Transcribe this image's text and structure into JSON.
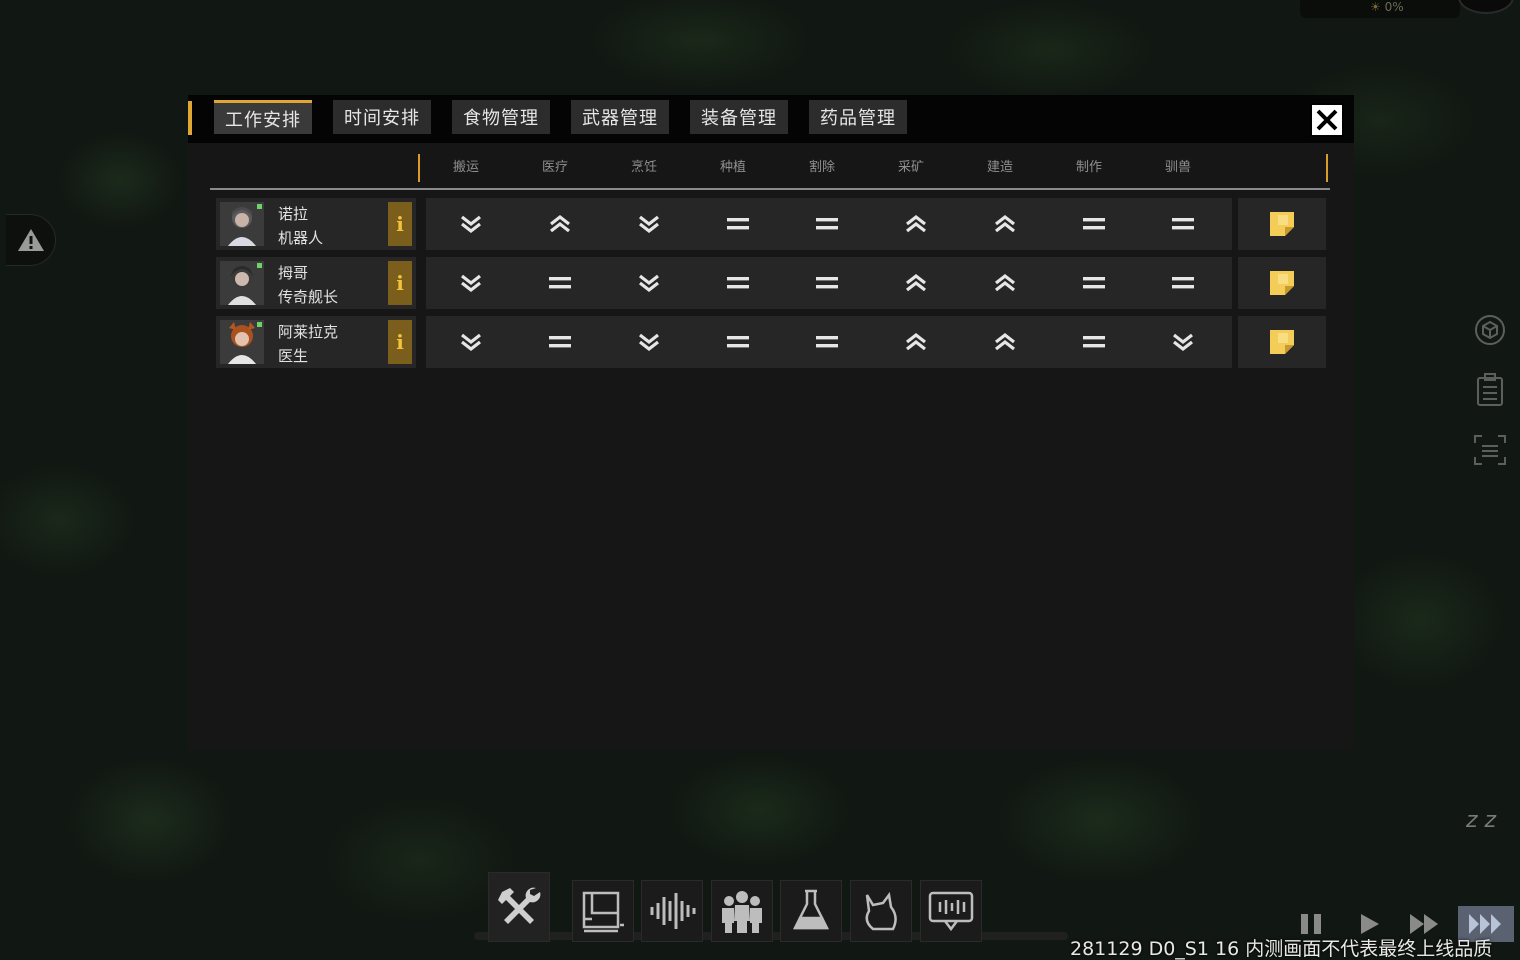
{
  "hud": {
    "top_right_text": "0%"
  },
  "tabs": [
    {
      "label": "工作安排",
      "active": true
    },
    {
      "label": "时间安排",
      "active": false
    },
    {
      "label": "食物管理",
      "active": false
    },
    {
      "label": "武器管理",
      "active": false
    },
    {
      "label": "装备管理",
      "active": false
    },
    {
      "label": "药品管理",
      "active": false
    }
  ],
  "columns": [
    "搬运",
    "医疗",
    "烹饪",
    "种植",
    "割除",
    "采矿",
    "建造",
    "制作",
    "驯兽"
  ],
  "priority_icons": {
    "up": "chevron-up-double-icon",
    "down": "chevron-down-double-icon",
    "normal": "equals-icon"
  },
  "colonists": [
    {
      "name": "诺拉",
      "role": "机器人",
      "info_label": "i",
      "priorities": [
        "down",
        "up",
        "down",
        "normal",
        "normal",
        "up",
        "up",
        "normal",
        "normal"
      ]
    },
    {
      "name": "拇哥",
      "role": "传奇舰长",
      "info_label": "i",
      "priorities": [
        "down",
        "normal",
        "down",
        "normal",
        "normal",
        "up",
        "up",
        "normal",
        "normal"
      ]
    },
    {
      "name": "阿莱拉克",
      "role": "医生",
      "info_label": "i",
      "priorities": [
        "down",
        "normal",
        "down",
        "normal",
        "normal",
        "up",
        "up",
        "normal",
        "down"
      ]
    }
  ],
  "toolbar": [
    "hammer-wrench-icon",
    "blueprint-icon",
    "soundwave-icon",
    "people-icon",
    "flask-icon",
    "animal-icon",
    "chat-icon"
  ],
  "speed_controls": [
    "pause-icon",
    "play-icon",
    "fast-forward-icon",
    "ultra-fast-icon"
  ],
  "build_info": "281129 D0_S1 16  内测画面不代表最终上线品质",
  "colors": {
    "accent": "#e0a833",
    "panel": "#161616",
    "cell": "#262626",
    "note": "#f4cc58"
  }
}
